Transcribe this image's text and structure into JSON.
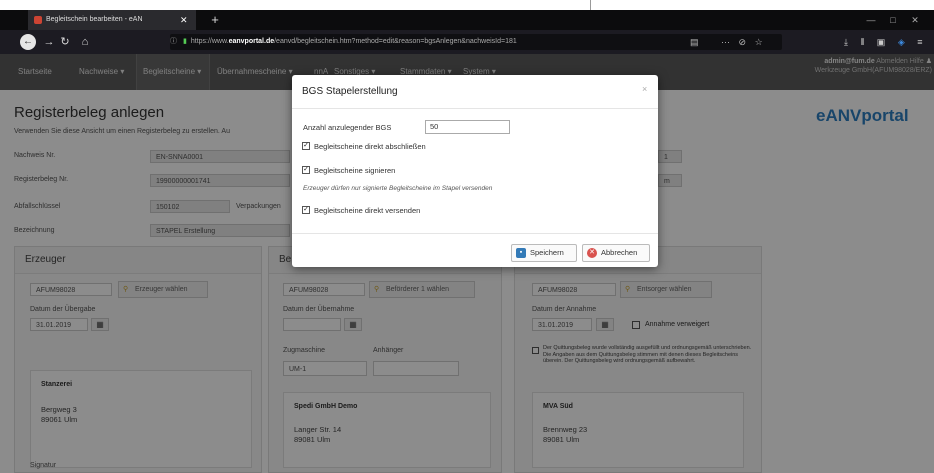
{
  "browser": {
    "tab_title": "Begleitschein bearbeiten - eAN",
    "tab_close": "✕",
    "new_tab": "+",
    "url_prefix": "https://www.",
    "url_domain": "eanvportal.de",
    "url_rest": "/eanvd/begleitschein.htm?method=edit&reason=bgsAnlegen&nachweisId=181",
    "window_controls": [
      "—",
      "□",
      "✕"
    ]
  },
  "menu": {
    "items": [
      "Startseite",
      "Nachweise ▾",
      "Begleitscheine ▾",
      "Übernahmescheine ▾",
      "nnA",
      "Sonstiges ▾",
      "Stammdaten ▾",
      "System ▾"
    ]
  },
  "user": {
    "email": "admin@fum.de",
    "links": "Abmelden  Hilfe",
    "company": "Werkzeuge GmbH(AFUM98028/ERZ)"
  },
  "page": {
    "title": "Registerbeleg anlegen",
    "description": "Verwenden Sie diese Ansicht um einen Registerbeleg zu erstellen. Au",
    "brand": "eANVportal"
  },
  "form": {
    "nachweis_label": "Nachweis Nr.",
    "nachweis_value": "EN-SNNA0001",
    "registerbeleg_label": "Registerbeleg Nr.",
    "registerbeleg_value": "19900000001741",
    "abfall_label": "Abfallschlüssel",
    "abfall_value": "150102",
    "verpackung_label": "Verpackungen",
    "bezeichnung_label": "Bezeichnung",
    "bezeichnung_value": "STAPEL Erstellung",
    "right_val1": "1",
    "right_val2": "m"
  },
  "erzeuger": {
    "header": "Erzeuger",
    "id": "AFUM98028",
    "button": "Erzeuger wählen",
    "date_label": "Datum der Übergabe",
    "date_value": "31.01.2019",
    "name": "Stanzerei",
    "street": "Bergweg 3",
    "city": "89061 Ulm",
    "signatur_label": "Signatur"
  },
  "befoerderer": {
    "header": "Be",
    "id": "AFUM98028",
    "button": "Beförderer 1 wählen",
    "date_label": "Datum der Übernahme",
    "zug_label": "Zugmaschine",
    "anh_label": "Anhänger",
    "zug_value": "UM-1",
    "name": "Spedi GmbH Demo",
    "street": "Langer Str. 14",
    "city": "89081 Ulm"
  },
  "entsorger": {
    "id": "AFUM98028",
    "button": "Entsorger wählen",
    "date_label": "Datum der Annahme",
    "date_value": "31.01.2019",
    "refuse_label": "Annahme verweigert",
    "note": "Der Quittungsbeleg wurde vollständig ausgefüllt und ordnungsgemäß unterschrieben. Die Angaben aus dem Quittungsbeleg stimmen mit denen dieses Begleitscheins überein. Der Quittungsbeleg wird ordnungsgemäß aufbewahrt.",
    "name": "MVA Süd",
    "street": "Brennweg 23",
    "city": "89081 Ulm"
  },
  "modal": {
    "title": "BGS Stapelerstellung",
    "close": "×",
    "count_label": "Anzahl anzulegender BGS",
    "count_value": "50",
    "opt_close": "Begleitscheine direkt abschließen",
    "opt_sign": "Begleitscheine signieren",
    "hint": "Erzeuger dürfen nur signierte Begleitscheine im Stapel versenden",
    "opt_send": "Begleitscheine direkt versenden",
    "save": "Speichern",
    "cancel": "Abbrechen"
  },
  "colors": {
    "brand": "#2d7fc1",
    "menu_bg": "#5b5b5b",
    "cancel_icon": "#d9534f",
    "save_icon": "#337ab7"
  }
}
